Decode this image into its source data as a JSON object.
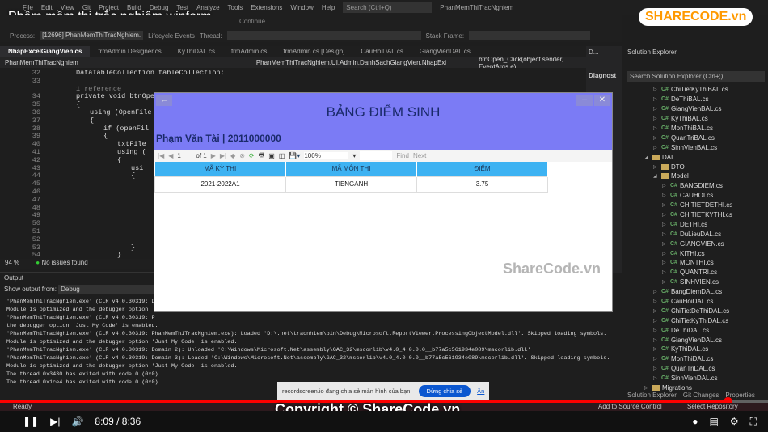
{
  "video": {
    "title": "Phầm mềm thi trắc nghiệm winform",
    "time": "8:09 / 8:36",
    "progress": 0.948,
    "copyright": "Copyright © ShareCode.vn",
    "watermark": "ShareCode.vn",
    "logo": "SHARECODE.vn"
  },
  "menu": [
    "File",
    "Edit",
    "View",
    "Git",
    "Project",
    "Build",
    "Debug",
    "Test",
    "Analyze",
    "Tools",
    "Extensions",
    "Window",
    "Help"
  ],
  "search_placeholder": "Search (Ctrl+Q)",
  "solution_name": "PhanMemThiTracNghiem",
  "process": {
    "label": "Process:",
    "value": "[12696] PhanMemThiTracNghiem.",
    "lifecycle": "Lifecycle Events",
    "thread": "Thread:",
    "stack": "Stack Frame:",
    "continue": "Continue"
  },
  "tabs": [
    "NhapExcelGiangVien.cs",
    "frmAdmin.Designer.cs",
    "KyThiDAL.cs",
    "frmAdmin.cs",
    "frmAdmin.cs [Design]",
    "CauHoiDAL.cs",
    "GiangVienDAL.cs"
  ],
  "nav": [
    "PhanMemThiTracNghiem",
    "PhanMemThiTracNghiem.UI.Admin.DanhSachGiangVien.NhapExi",
    "btnOpen_Click(object sender, EventArgs e)"
  ],
  "code": {
    "lines": [
      {
        "n": "32",
        "t": "DataTableCollection tableCollection;",
        "i": 4
      },
      {
        "n": "33",
        "t": "",
        "i": 0
      },
      {
        "n": "",
        "t": "1 reference",
        "i": 4
      },
      {
        "n": "34",
        "t": "private void btnOpen",
        "i": 4
      },
      {
        "n": "35",
        "t": "{",
        "i": 4
      },
      {
        "n": "36",
        "t": "using (OpenFile",
        "i": 6
      },
      {
        "n": "37",
        "t": "{",
        "i": 6
      },
      {
        "n": "38",
        "t": "if (openFil",
        "i": 8
      },
      {
        "n": "39",
        "t": "{",
        "i": 8
      },
      {
        "n": "40",
        "t": "txtFile",
        "i": 10
      },
      {
        "n": "41",
        "t": "using (",
        "i": 10
      },
      {
        "n": "42",
        "t": "{",
        "i": 10
      },
      {
        "n": "43",
        "t": "usi",
        "i": 12
      },
      {
        "n": "44",
        "t": "{",
        "i": 12
      },
      {
        "n": "45",
        "t": "",
        "i": 0
      },
      {
        "n": "46",
        "t": "",
        "i": 0
      },
      {
        "n": "47",
        "t": "",
        "i": 0
      },
      {
        "n": "48",
        "t": "",
        "i": 0
      },
      {
        "n": "49",
        "t": "",
        "i": 0
      },
      {
        "n": "50",
        "t": "",
        "i": 0
      },
      {
        "n": "51",
        "t": "",
        "i": 0
      },
      {
        "n": "52",
        "t": "",
        "i": 0
      },
      {
        "n": "53",
        "t": "}",
        "i": 12
      },
      {
        "n": "54",
        "t": "}",
        "i": 10
      }
    ]
  },
  "code_status": {
    "zoom": "94 %",
    "issues": "No issues found"
  },
  "output": {
    "title": "Output",
    "show_from": "Show output from:",
    "source": "Debug",
    "lines": [
      "'PhanMemThiTracNghiem.exe' (CLR v4.0.30319: D",
      "  Module is optimized and the debugger option",
      "'PhanMemThiTracNghiem.exe' (CLR v4.0.30319: P",
      "  the debugger option 'Just My Code' is enabled.",
      "'PhanMemThiTracNghiem.exe' (CLR v4.0.30319: PhanMemThiTracNghiem.exe): Loaded 'D:\\.net\\tracnhiem\\bin\\Debug\\Microsoft.ReportViewer.ProcessingObjectModel.dll'. Skipped loading symbols.",
      "  Module is optimized and the debugger option 'Just My Code' is enabled.",
      "'PhanMemThiTracNghiem.exe' (CLR v4.0.30319: Domain 2): Unloaded 'C:\\Windows\\Microsoft.Net\\assembly\\GAC_32\\mscorlib\\v4.0_4.0.0.0__b77a5c561934e089\\mscorlib.dll'",
      "'PhanMemThiTracNghiem.exe' (CLR v4.0.30319: Domain 3): Loaded 'C:\\Windows\\Microsoft.Net\\assembly\\GAC_32\\mscorlib\\v4.0_4.0.0.0__b77a5c561934e089\\mscorlib.dll'. Skipped loading symbols.",
      "  Module is optimized and the debugger option 'Just My Code' is enabled.",
      "The thread 0x3430 has exited with code 0 (0x0).",
      "The thread 0x1ce4 has exited with code 0 (0x0)."
    ]
  },
  "diag": {
    "title": "D...",
    "label": "Diagnost"
  },
  "solution_explorer": {
    "title": "Solution Explorer",
    "search": "Search Solution Explorer (Ctrl+;)",
    "items": [
      {
        "l": "ChiTietKyThiBAL.cs",
        "d": 2,
        "k": "cs"
      },
      {
        "l": "DeThiBAL.cs",
        "d": 2,
        "k": "cs"
      },
      {
        "l": "GiangVienBAL.cs",
        "d": 2,
        "k": "cs"
      },
      {
        "l": "KyThiBAL.cs",
        "d": 2,
        "k": "cs"
      },
      {
        "l": "MonThiBAL.cs",
        "d": 2,
        "k": "cs"
      },
      {
        "l": "QuanTriBAL.cs",
        "d": 2,
        "k": "cs"
      },
      {
        "l": "SinhVienBAL.cs",
        "d": 2,
        "k": "cs"
      },
      {
        "l": "DAL",
        "d": 1,
        "k": "folder"
      },
      {
        "l": "DTO",
        "d": 2,
        "k": "folder"
      },
      {
        "l": "Model",
        "d": 2,
        "k": "folder"
      },
      {
        "l": "BANGDIEM.cs",
        "d": 3,
        "k": "cs"
      },
      {
        "l": "CAUHOI.cs",
        "d": 3,
        "k": "cs"
      },
      {
        "l": "CHITIETDETHI.cs",
        "d": 3,
        "k": "cs"
      },
      {
        "l": "CHITIETKYTHI.cs",
        "d": 3,
        "k": "cs"
      },
      {
        "l": "DETHI.cs",
        "d": 3,
        "k": "cs"
      },
      {
        "l": "DuLieuDAL.cs",
        "d": 3,
        "k": "cs"
      },
      {
        "l": "GIANGVIEN.cs",
        "d": 3,
        "k": "cs"
      },
      {
        "l": "KITHI.cs",
        "d": 3,
        "k": "cs"
      },
      {
        "l": "MONTHI.cs",
        "d": 3,
        "k": "cs"
      },
      {
        "l": "QUANTRI.cs",
        "d": 3,
        "k": "cs"
      },
      {
        "l": "SINHVIEN.cs",
        "d": 3,
        "k": "cs"
      },
      {
        "l": "BangDiemDAL.cs",
        "d": 2,
        "k": "cs"
      },
      {
        "l": "CauHoiDAL.cs",
        "d": 2,
        "k": "cs"
      },
      {
        "l": "ChiTietDeThiDAL.cs",
        "d": 2,
        "k": "cs"
      },
      {
        "l": "ChiTietKyThiDAL.cs",
        "d": 2,
        "k": "cs"
      },
      {
        "l": "DeThiDAL.cs",
        "d": 2,
        "k": "cs"
      },
      {
        "l": "GiangVienDAL.cs",
        "d": 2,
        "k": "cs"
      },
      {
        "l": "KyThiDAL.cs",
        "d": 2,
        "k": "cs"
      },
      {
        "l": "MonThiDAL.cs",
        "d": 2,
        "k": "cs"
      },
      {
        "l": "QuanTriDAL.cs",
        "d": 2,
        "k": "cs"
      },
      {
        "l": "SinhVienDAL.cs",
        "d": 2,
        "k": "cs"
      },
      {
        "l": "Migrations",
        "d": 1,
        "k": "folder"
      }
    ],
    "tabs": [
      "Solution Explorer",
      "Git Changes",
      "Properties"
    ]
  },
  "report": {
    "title": "BẢNG ĐIỂM SINH",
    "student": "Phạm Văn Tài | 2011000000",
    "page": "1",
    "of": "of 1",
    "zoom": "100%",
    "find": "Find",
    "next": "Next",
    "columns": [
      "MÃ KỲ THI",
      "MÃ MÔN THI",
      "ĐIỂM"
    ],
    "rows": [
      [
        "2021-2022A1",
        "TIENGANH",
        "3.75"
      ]
    ],
    "header_color": "#7b7bf5",
    "col_header_color": "#3db2f2"
  },
  "notification": {
    "text": "recordscreen.io đang chia sẻ màn hình của bạn.",
    "stop": "Dừng chia sẻ",
    "hide": "Ẩn"
  },
  "statusbar": {
    "ready": "Ready",
    "source_control": "Add to Source Control",
    "repo": "Select Repository"
  }
}
